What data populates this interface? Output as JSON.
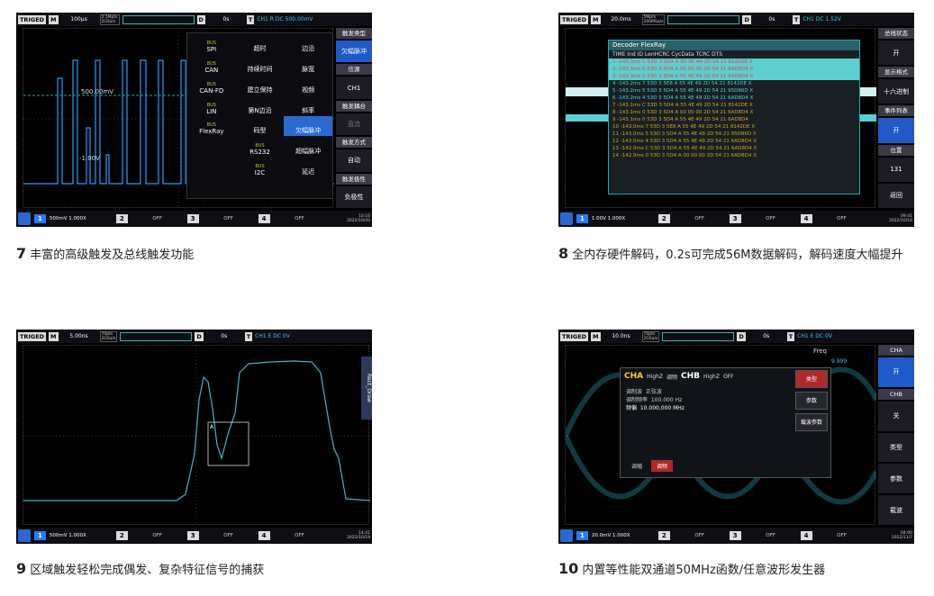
{
  "panels": [
    {
      "top": {
        "trig": "TRIGED",
        "mode": "M",
        "timebase": "100µs",
        "sr1": "2.5Mpts",
        "sr2": "2GSa/s",
        "D": "D",
        "dval": "0s",
        "T": "T",
        "trigtxt": "CH1 R DC 500.00mV"
      },
      "labels": {
        "level1": "500.00mV",
        "level2": "-1.00V"
      },
      "menu": [
        {
          "ic": "BUS",
          "t": "SPI"
        },
        {
          "ic": "",
          "t": "超时"
        },
        {
          "ic": "",
          "t": "边沿"
        },
        {
          "ic": "BUS",
          "t": "CAN"
        },
        {
          "ic": "",
          "t": "持续时间"
        },
        {
          "ic": "",
          "t": "脉宽"
        },
        {
          "ic": "BUS",
          "t": "CAN-FD"
        },
        {
          "ic": "",
          "t": "建立保持"
        },
        {
          "ic": "",
          "t": "视频"
        },
        {
          "ic": "BUS",
          "t": "LIN"
        },
        {
          "ic": "",
          "t": "第N边沿"
        },
        {
          "ic": "",
          "t": "斜率"
        },
        {
          "ic": "BUS",
          "t": "FlexRay"
        },
        {
          "ic": "",
          "t": "码型"
        },
        {
          "ic": "",
          "t": "欠幅脉冲"
        },
        {
          "ic": "",
          "t": ""
        },
        {
          "ic": "BUS",
          "t": "RS232"
        },
        {
          "ic": "",
          "t": "超幅脉冲"
        },
        {
          "ic": "",
          "t": ""
        },
        {
          "ic": "BUS",
          "t": "I2C"
        },
        {
          "ic": "",
          "t": "延迟"
        }
      ],
      "side": [
        "触发类型",
        "欠幅脉冲",
        "信源",
        "CH1",
        "触发耦合",
        "直流",
        "触发方式",
        "自动",
        "触发极性",
        "负极性"
      ],
      "bottom": {
        "ch1": "1",
        "ch1txt": "500mV 1.000X",
        "ch2": "2",
        "ch3": "3",
        "ch4": "4",
        "off": "OFF",
        "time": "10:16",
        "date": "2022/10/20"
      },
      "caption": {
        "num": "7",
        "text": "丰富的高级触发及总线触发功能"
      }
    },
    {
      "top": {
        "trig": "TRIGED",
        "mode": "M",
        "timebase": "20.0ms",
        "sr1": "5Mpts",
        "sr2": "200MSa/s",
        "D": "D",
        "dval": "0s",
        "T": "T",
        "trigtxt": "CH1 DC 1.52V"
      },
      "decoder": {
        "title": "Decoder FlexRay",
        "cols": "TIME        Ind ID   LenHCRC CycData                                    TCRC    DTS",
        "rows": [
          "1  -143.3ms   C   53D 3    5D4  A   55 4E 49 2D 54 21         8142DE  X",
          "2  -143.3ms   0   53D 3    5D4  A   00 00 00 2D 54 21         6AD8D4  X",
          "3  -143.3ms   0   53D 3    5D4  A   55 4E 49 2D 54 21         6AD8D4  X",
          "4  -143.2ms   7   53D 3    5E8  A   55 4E 49 2D 54 21         8142DE  X",
          "5  -143.2ms   5   53D 3    5D4  A   55 4E 49 2D 54 21         95D86D  X",
          "6  -143.2ms   4   53D 3    5D4  A   55 4E 49 2D 54 21         6AD8D4  X",
          "7  -143.1ms   C   53D 3    5D4  A   55 4E 49 2D 54 21         8142DE  X",
          "8  -143.1ms   0   53D 3    5D4  A   00 00 00 2D 54 21         6AD8D4  X",
          "9  -143.1ms   0   53D 3    5D4  A   55 4E 49 2D 54 21         6AD8D4",
          "10 -143.0ms   7   53D 3    5E8  A   55 4E 49 2D 54 21         8142DE  X",
          "11 -143.0ms   5   53D 3    5D4  A   55 4E 49 2D 54 21         95D86D  X",
          "12 -143.0ms   4   53D 3    5D4  A   55 4E 49 2D 54 21         6AD8D4  X",
          "13 -142.9ms   C   53D 3    5D4  A   55 4E 49 2D 54 21         6AD8D4  X",
          "14 -142.9ms   0   53D 3    5D4  A   00 00 00 2D 54 21         6AD8D4  X"
        ]
      },
      "side": [
        "总线状态",
        "开",
        "显示格式",
        "十六进制",
        "事件列表",
        "开",
        "位置",
        "131",
        "返回"
      ],
      "vert": "DecodeBus / Decode",
      "bottom": {
        "ch1": "1",
        "ch1txt": "1.00V 1.000X",
        "ch2": "2",
        "ch3": "3",
        "ch4": "4",
        "off": "OFF",
        "time": "09:41",
        "date": "2022/10/16"
      },
      "caption": {
        "num": "8",
        "text": "全内存硬件解码，0.2s可完成56M数据解码，解码速度大幅提升"
      }
    },
    {
      "top": {
        "trig": "TRIGED",
        "mode": "M",
        "timebase": "5.00ns",
        "sr1": "70pts",
        "sr2": "2GSa/s",
        "D": "D",
        "dval": "0s",
        "T": "T",
        "trigtxt": "CH1 E DC 0V"
      },
      "vert": "Rect_Draw",
      "bottom": {
        "ch1": "1",
        "ch1txt": "500mV 1.000X",
        "ch2": "2",
        "ch3": "3",
        "ch4": "4",
        "off": "OFF",
        "time": "14:41",
        "date": "2022/10/19"
      },
      "caption": {
        "num": "9",
        "text": "区域触发轻松完成偶发、复杂特征信号的捕获"
      }
    },
    {
      "top": {
        "trig": "TRIGED",
        "mode": "M",
        "timebase": "10.0ns",
        "sr1": "70pts",
        "sr2": "2GSa/s",
        "D": "D",
        "dval": "0s",
        "T": "T",
        "trigtxt": "CH1 E DC 0V"
      },
      "awg": {
        "cha": "CHA",
        "hz1": "HighZ",
        "mod": "调频",
        "chb": "CHB",
        "hz2": "HighZ",
        "off": "OFF",
        "rows": [
          [
            "调制波",
            "正弦波"
          ],
          [
            "调制频率",
            "100.000 Hz"
          ],
          [
            "频偏",
            "10.000,000 MHz"
          ]
        ],
        "btns": [
          "类型",
          "参数",
          "载波参数"
        ],
        "tabs": [
          "调幅",
          "调频"
        ],
        "freq": "Freq",
        "freqval": "9.999"
      },
      "side": [
        "CHA",
        "开",
        "CHB",
        "关",
        "类型",
        "参数",
        "载波"
      ],
      "vert": "AWG_MOD",
      "bottom": {
        "ch1": "1",
        "ch1txt": "20.0mV 1.000X",
        "ch2": "2",
        "ch3": "3",
        "ch4": "4",
        "off": "OFF",
        "time": "04:00",
        "date": "2022/11/7"
      },
      "caption": {
        "num": "10",
        "text": "内置等性能双通道50MHz函数/任意波形发生器"
      }
    }
  ]
}
